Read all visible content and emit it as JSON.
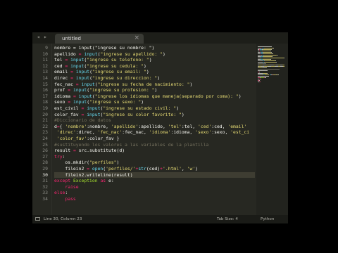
{
  "colors": {
    "background": "#272822",
    "variable": "#f8f8f2",
    "operator": "#f92672",
    "function": "#66d9ef",
    "string": "#e6db74",
    "keyword": "#f92672",
    "comment": "#75715e",
    "exception": "#a6e22e"
  },
  "tab": {
    "title": "untitled",
    "close_icon": "×"
  },
  "editor": {
    "active_line": 30,
    "line_numbers": [
      9,
      10,
      11,
      12,
      13,
      14,
      15,
      16,
      17,
      18,
      19,
      20,
      21,
      22,
      23,
      24,
      25,
      26,
      27,
      28,
      29,
      30,
      31,
      32,
      33,
      34
    ],
    "lines": [
      [
        [
          "v",
          "nombre = input(\"ingrese su nombre: \")"
        ]
      ],
      [
        [
          "v",
          "apellido "
        ],
        [
          "o",
          "="
        ],
        [
          "v",
          " "
        ],
        [
          "f",
          "input"
        ],
        [
          "v",
          "("
        ],
        [
          "s",
          "\"ingrese su apellido: \""
        ],
        [
          "v",
          ")"
        ]
      ],
      [
        [
          "v",
          "tel "
        ],
        [
          "o",
          "="
        ],
        [
          "v",
          " "
        ],
        [
          "f",
          "input"
        ],
        [
          "v",
          "("
        ],
        [
          "s",
          "\"ingrese su telefono: \""
        ],
        [
          "v",
          ")"
        ]
      ],
      [
        [
          "v",
          "ced "
        ],
        [
          "o",
          "="
        ],
        [
          "v",
          " "
        ],
        [
          "f",
          "input"
        ],
        [
          "v",
          "("
        ],
        [
          "s",
          "\"ingrese su cedula: \""
        ],
        [
          "v",
          ")"
        ]
      ],
      [
        [
          "v",
          "email "
        ],
        [
          "o",
          "="
        ],
        [
          "v",
          " "
        ],
        [
          "f",
          "input"
        ],
        [
          "v",
          "("
        ],
        [
          "s",
          "\"ingrese su email: \""
        ],
        [
          "v",
          ")"
        ]
      ],
      [
        [
          "v",
          "direc "
        ],
        [
          "o",
          "="
        ],
        [
          "v",
          " "
        ],
        [
          "f",
          "input"
        ],
        [
          "v",
          "("
        ],
        [
          "s",
          "\"ingrese su direccion: \""
        ],
        [
          "v",
          ")"
        ]
      ],
      [
        [
          "v",
          "fec_nac "
        ],
        [
          "o",
          "="
        ],
        [
          "v",
          " "
        ],
        [
          "f",
          "input"
        ],
        [
          "v",
          "("
        ],
        [
          "s",
          "\"ingrese su fecha de nacimiento: \""
        ],
        [
          "v",
          ")"
        ]
      ],
      [
        [
          "v",
          "prof "
        ],
        [
          "o",
          "="
        ],
        [
          "v",
          " "
        ],
        [
          "f",
          "input"
        ],
        [
          "v",
          "("
        ],
        [
          "s",
          "\"ingrese su profesion: \""
        ],
        [
          "v",
          ")"
        ]
      ],
      [
        [
          "v",
          "idioma "
        ],
        [
          "o",
          "="
        ],
        [
          "v",
          " "
        ],
        [
          "f",
          "input"
        ],
        [
          "v",
          "("
        ],
        [
          "s",
          "\"ingrese los idiomas que maneja(separado por coma): \""
        ],
        [
          "v",
          ")"
        ]
      ],
      [
        [
          "v",
          "sexo "
        ],
        [
          "o",
          "="
        ],
        [
          "v",
          " "
        ],
        [
          "f",
          "input"
        ],
        [
          "v",
          "("
        ],
        [
          "s",
          "\"ingrese su sexo: \""
        ],
        [
          "v",
          ")"
        ]
      ],
      [
        [
          "v",
          "est_civil "
        ],
        [
          "o",
          "="
        ],
        [
          "v",
          " "
        ],
        [
          "f",
          "input"
        ],
        [
          "v",
          "("
        ],
        [
          "s",
          "\"ingrese su estado civil: \""
        ],
        [
          "v",
          ")"
        ]
      ],
      [
        [
          "v",
          "color_fav "
        ],
        [
          "o",
          "="
        ],
        [
          "v",
          " "
        ],
        [
          "f",
          "input"
        ],
        [
          "v",
          "("
        ],
        [
          "s",
          "\"ingrese su color favorito: \""
        ],
        [
          "v",
          ")"
        ]
      ],
      [
        [
          "c",
          "#Diccionario de datos"
        ]
      ],
      [
        [
          "v",
          "d"
        ],
        [
          "o",
          "="
        ],
        [
          "v",
          "{ "
        ],
        [
          "s",
          "'nombre'"
        ],
        [
          "v",
          ":nombre, "
        ],
        [
          "s",
          "'apellido'"
        ],
        [
          "v",
          ":apellido, "
        ],
        [
          "s",
          "'tel'"
        ],
        [
          "v",
          ":tel, "
        ],
        [
          "s",
          "'ced'"
        ],
        [
          "v",
          ":ced, "
        ],
        [
          "s",
          "'email'"
        ]
      ],
      [
        [
          "v",
          " "
        ],
        [
          "s",
          "'direc'"
        ],
        [
          "v",
          ":direc, "
        ],
        [
          "s",
          "'fec_nac'"
        ],
        [
          "v",
          ":fec_nac, "
        ],
        [
          "s",
          "'idioma'"
        ],
        [
          "v",
          ":idioma, "
        ],
        [
          "s",
          "'sexo'"
        ],
        [
          "v",
          ":sexo, "
        ],
        [
          "s",
          "'est_ci"
        ]
      ],
      [
        [
          "v",
          " "
        ],
        [
          "s",
          "'color_fav'"
        ],
        [
          "v",
          ":color_fav }"
        ]
      ],
      [
        [
          "c",
          "#sustituyendo los valores a las variables de la plantilla"
        ]
      ],
      [
        [
          "v",
          "result "
        ],
        [
          "o",
          "="
        ],
        [
          "v",
          " src.substitute(d)"
        ]
      ],
      [
        [
          "k",
          "try"
        ],
        [
          "v",
          ":"
        ]
      ],
      [
        [
          "v",
          "    os.mkdir("
        ],
        [
          "s",
          "\"perfiles\""
        ],
        [
          "v",
          ")"
        ]
      ],
      [
        [
          "v",
          "    filein2 "
        ],
        [
          "o",
          "="
        ],
        [
          "v",
          " "
        ],
        [
          "f",
          "open"
        ],
        [
          "v",
          "("
        ],
        [
          "s",
          "'perfiles/'"
        ],
        [
          "o",
          "+"
        ],
        [
          "f",
          "str"
        ],
        [
          "v",
          "(ced)"
        ],
        [
          "o",
          "+"
        ],
        [
          "s",
          "'.html'"
        ],
        [
          "v",
          ", "
        ],
        [
          "s",
          "'w'"
        ],
        [
          "v",
          ")"
        ]
      ],
      [
        [
          "v",
          "    filein2.writeline(result)"
        ]
      ],
      [
        [
          "k",
          "except"
        ],
        [
          "v",
          " "
        ],
        [
          "e",
          "Exception"
        ],
        [
          "v",
          " "
        ],
        [
          "k",
          "as"
        ],
        [
          "v",
          " e:"
        ]
      ],
      [
        [
          "v",
          "    "
        ],
        [
          "k",
          "raise"
        ]
      ],
      [
        [
          "k",
          "else"
        ],
        [
          "v",
          ":"
        ]
      ],
      [
        [
          "v",
          "    "
        ],
        [
          "k",
          "pass"
        ]
      ]
    ]
  },
  "status_bar": {
    "position": "Line 30, Column 23",
    "tab_size": "Tab Size: 4",
    "syntax": "Python"
  },
  "icons": {
    "tab_nav": "tab-scroll-arrows-icon",
    "status_panel": "panel-toggle-icon"
  }
}
